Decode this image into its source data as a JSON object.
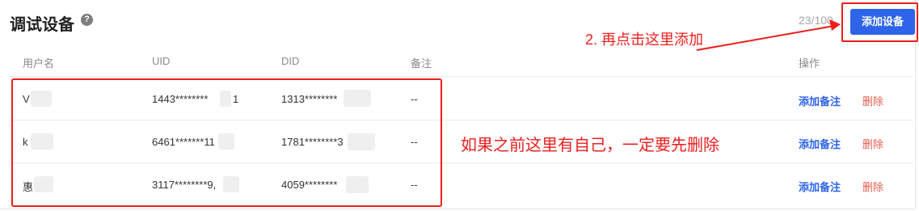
{
  "header": {
    "title": "调试设备",
    "help_icon": "question-mark-icon",
    "quota": "23/100",
    "add_device_label": "添加设备"
  },
  "table": {
    "columns": [
      "用户名",
      "UID",
      "DID",
      "备注",
      "操作"
    ],
    "rows": [
      {
        "user": "V",
        "uid": "1443********",
        "uid_tail": "1",
        "did": "1313********",
        "note": "--",
        "action_note": "添加备注",
        "action_delete": "删除"
      },
      {
        "user": "k",
        "uid": "6461*******11",
        "uid_tail": "",
        "did": "1781********3",
        "note": "--",
        "action_note": "添加备注",
        "action_delete": "删除"
      },
      {
        "user": "惠",
        "uid": "3117********9,",
        "uid_tail": "",
        "did": "4059********",
        "note": "--",
        "action_note": "添加备注",
        "action_delete": "删除"
      }
    ]
  },
  "annotations": {
    "step2": "2. 再点击这里添加",
    "remove_self": "如果之前这里有自己，一定要先删除"
  },
  "colors": {
    "accent": "#2d64e9",
    "danger": "#e55b4f",
    "annotation": "#ec1e1e"
  }
}
